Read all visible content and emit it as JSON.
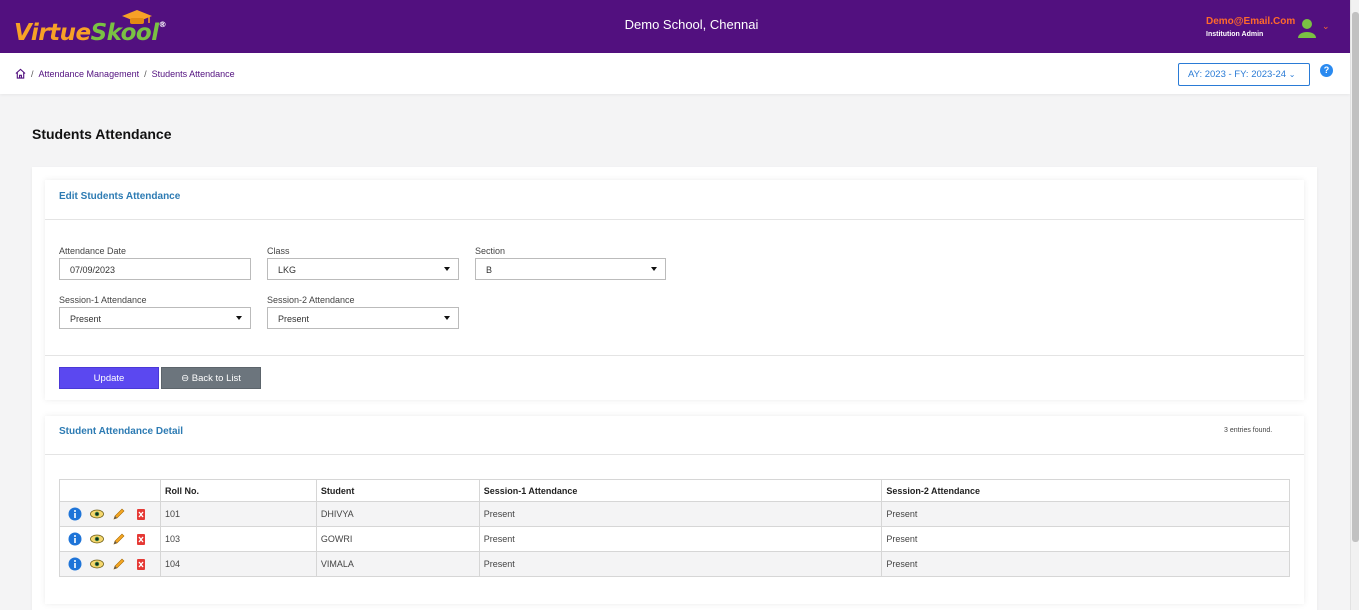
{
  "header": {
    "logo_text": "VirtueSkool",
    "school_name": "Demo School, Chennai",
    "user_email": "Demo@Email.Com",
    "user_role": "Institution Admin"
  },
  "breadcrumb": {
    "items": [
      "Attendance Management",
      "Students Attendance"
    ],
    "separator": "/"
  },
  "academic_year": "AY: 2023 - FY: 2023-24",
  "help_label": "?",
  "page_title": "Students Attendance",
  "edit_panel": {
    "title": "Edit Students Attendance",
    "fields": {
      "attendance_date": {
        "label": "Attendance Date",
        "value": "07/09/2023"
      },
      "class": {
        "label": "Class",
        "value": "LKG"
      },
      "section": {
        "label": "Section",
        "value": "B"
      },
      "session1": {
        "label": "Session-1 Attendance",
        "value": "Present"
      },
      "session2": {
        "label": "Session-2 Attendance",
        "value": "Present"
      }
    },
    "update_label": "Update",
    "back_label": "Back to List"
  },
  "detail_panel": {
    "title": "Student Attendance Detail",
    "entries_text": "3 entries found.",
    "columns": [
      "",
      "Roll No.",
      "Student",
      "Session-1 Attendance",
      "Session-2 Attendance"
    ],
    "rows": [
      {
        "roll": "101",
        "student": "DHIVYA",
        "s1": "Present",
        "s2": "Present"
      },
      {
        "roll": "103",
        "student": "GOWRI",
        "s1": "Present",
        "s2": "Present"
      },
      {
        "roll": "104",
        "student": "VIMALA",
        "s1": "Present",
        "s2": "Present"
      }
    ],
    "row_actions": [
      "info-icon",
      "view-eye-icon",
      "edit-pencil-icon",
      "delete-icon"
    ]
  },
  "colors": {
    "header_bg": "#52107f",
    "accent_orange": "#f7a127",
    "accent_green": "#7ac143",
    "update_button": "#5b48f0",
    "back_button": "#6c757d",
    "panel_title": "#2d7bb3"
  }
}
